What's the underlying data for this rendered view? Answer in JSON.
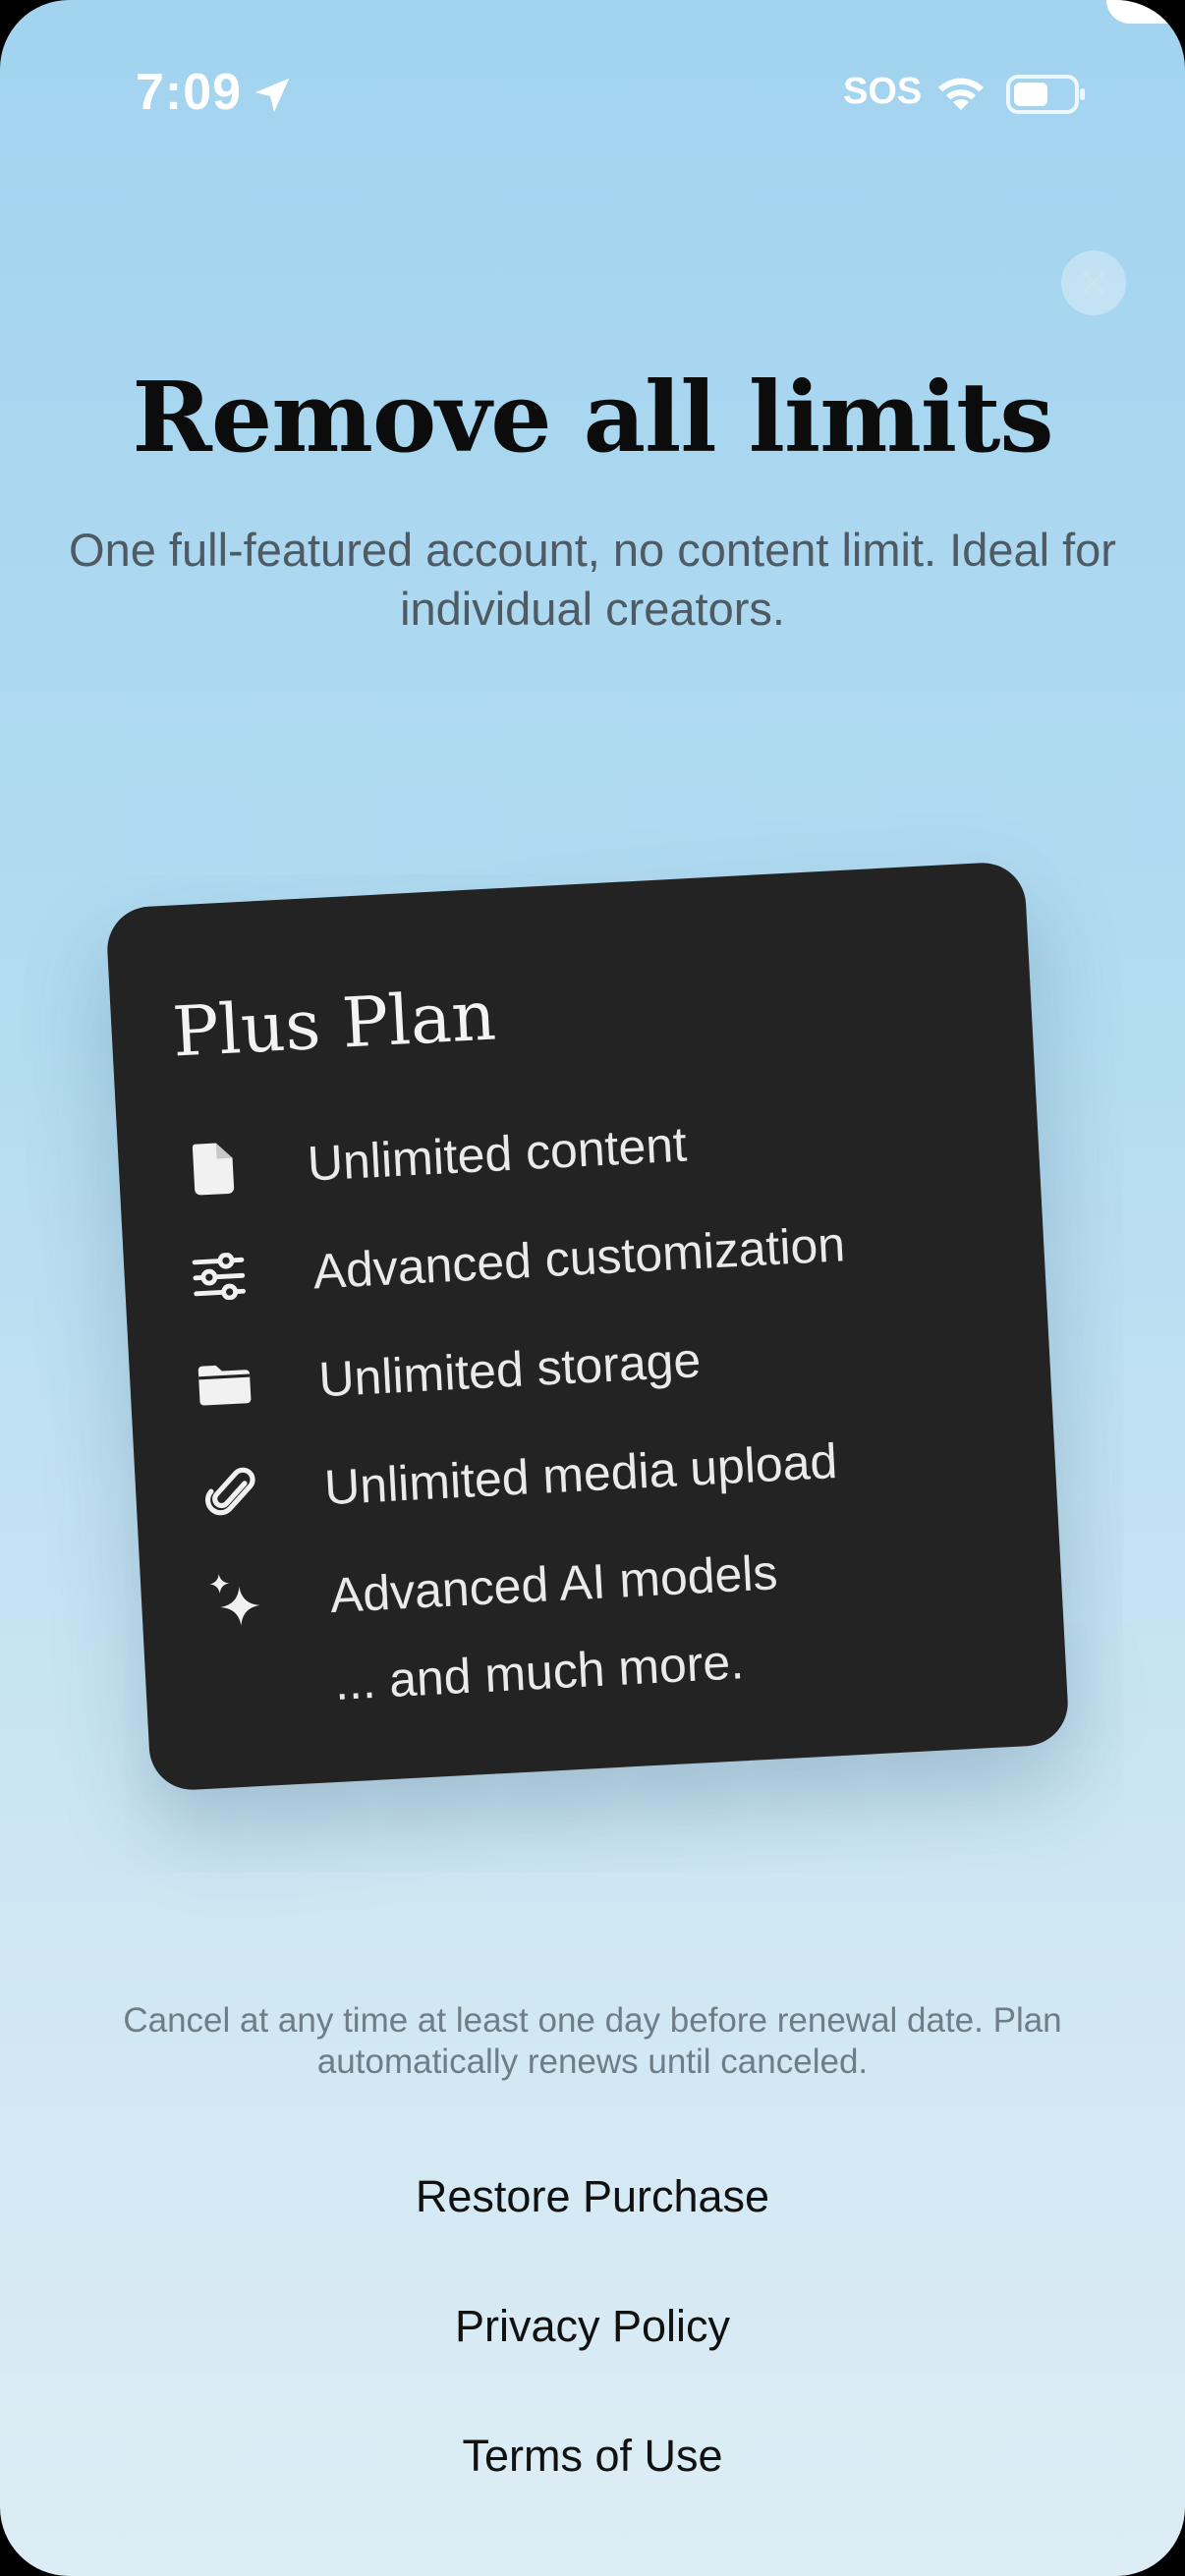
{
  "status_bar": {
    "time": "7:09",
    "sos": "SOS",
    "icons": [
      "location-arrow-icon",
      "wifi-icon",
      "battery-icon"
    ]
  },
  "close_icon": "close-icon",
  "header": {
    "title": "Remove all limits",
    "subtitle": "One full-featured account, no content limit. Ideal for individual creators."
  },
  "plan": {
    "name": "Plus Plan",
    "features": [
      {
        "icon": "document-icon",
        "label": "Unlimited content"
      },
      {
        "icon": "sliders-icon",
        "label": "Advanced customization"
      },
      {
        "icon": "folder-icon",
        "label": "Unlimited storage"
      },
      {
        "icon": "paperclip-icon",
        "label": "Unlimited media upload"
      },
      {
        "icon": "sparkles-icon",
        "label": "Advanced AI models"
      }
    ],
    "more": "... and much more."
  },
  "footer": {
    "legal": "Cancel at any time at least one day before renewal date. Plan automatically renews until canceled.",
    "restore": "Restore Purchase",
    "privacy": "Privacy Policy",
    "terms": "Terms of Use"
  },
  "colors": {
    "background_top": "#a2d3ef",
    "background_bottom": "#ddedf5",
    "card": "#232323",
    "title": "#0c0c0c"
  }
}
